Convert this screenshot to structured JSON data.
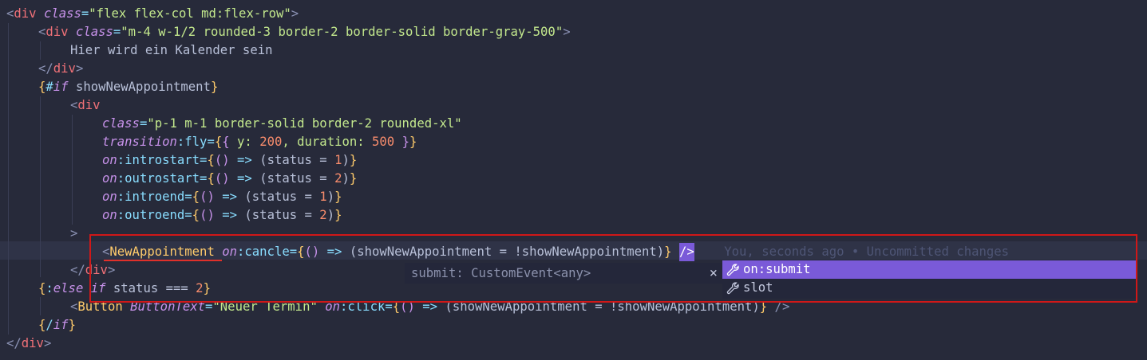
{
  "editor": {
    "lines": [
      {
        "tokens": [
          {
            "t": "<",
            "c": "lt"
          },
          {
            "t": "div",
            "c": "tag"
          },
          {
            "t": " ",
            "c": "plain"
          },
          {
            "t": "class",
            "c": "attr"
          },
          {
            "t": "=",
            "c": "op"
          },
          {
            "t": "\"flex flex-col md:flex-row\"",
            "c": "str"
          },
          {
            "t": ">",
            "c": "lt"
          }
        ]
      },
      {
        "tokens": [
          {
            "t": "<",
            "c": "lt"
          },
          {
            "t": "div",
            "c": "tag"
          },
          {
            "t": " ",
            "c": "plain"
          },
          {
            "t": "class",
            "c": "attr"
          },
          {
            "t": "=",
            "c": "op"
          },
          {
            "t": "\"m-4 w-1/2 rounded-3 border-2 border-solid border-gray-500\"",
            "c": "str"
          },
          {
            "t": ">",
            "c": "lt"
          }
        ]
      },
      {
        "tokens": [
          {
            "t": "Hier wird ein Kalender sein",
            "c": "plain"
          }
        ]
      },
      {
        "tokens": [
          {
            "t": "</",
            "c": "lt"
          },
          {
            "t": "div",
            "c": "tag"
          },
          {
            "t": ">",
            "c": "lt"
          }
        ]
      },
      {
        "tokens": [
          {
            "t": "{",
            "c": "brace"
          },
          {
            "t": "#",
            "c": "op"
          },
          {
            "t": "if",
            "c": "kw"
          },
          {
            "t": " showNewAppointment",
            "c": "plain"
          },
          {
            "t": "}",
            "c": "brace"
          }
        ]
      },
      {
        "tokens": [
          {
            "t": "<",
            "c": "lt"
          },
          {
            "t": "div",
            "c": "tag"
          }
        ]
      },
      {
        "tokens": [
          {
            "t": "class",
            "c": "attr"
          },
          {
            "t": "=",
            "c": "op"
          },
          {
            "t": "\"p-1 m-1 border-solid border-2 rounded-xl\"",
            "c": "str"
          }
        ]
      },
      {
        "tokens": [
          {
            "t": "transition",
            "c": "attr"
          },
          {
            "t": ":fly=",
            "c": "op"
          },
          {
            "t": "{",
            "c": "brace"
          },
          {
            "t": "{",
            "c": "brace2"
          },
          {
            "t": " y: ",
            "c": "prop"
          },
          {
            "t": "200",
            "c": "num"
          },
          {
            "t": ", duration: ",
            "c": "prop"
          },
          {
            "t": "500",
            "c": "num"
          },
          {
            "t": " }",
            "c": "brace2"
          },
          {
            "t": "}",
            "c": "brace"
          }
        ]
      },
      {
        "tokens": [
          {
            "t": "on",
            "c": "attr"
          },
          {
            "t": ":introstart=",
            "c": "op"
          },
          {
            "t": "{",
            "c": "brace"
          },
          {
            "t": "()",
            "c": "brace2"
          },
          {
            "t": " => ",
            "c": "op"
          },
          {
            "t": "(status = ",
            "c": "plain"
          },
          {
            "t": "1",
            "c": "num"
          },
          {
            "t": ")",
            "c": "plain"
          },
          {
            "t": "}",
            "c": "brace"
          }
        ]
      },
      {
        "tokens": [
          {
            "t": "on",
            "c": "attr"
          },
          {
            "t": ":outrostart=",
            "c": "op"
          },
          {
            "t": "{",
            "c": "brace"
          },
          {
            "t": "()",
            "c": "brace2"
          },
          {
            "t": " => ",
            "c": "op"
          },
          {
            "t": "(status = ",
            "c": "plain"
          },
          {
            "t": "2",
            "c": "num"
          },
          {
            "t": ")",
            "c": "plain"
          },
          {
            "t": "}",
            "c": "brace"
          }
        ]
      },
      {
        "tokens": [
          {
            "t": "on",
            "c": "attr"
          },
          {
            "t": ":introend=",
            "c": "op"
          },
          {
            "t": "{",
            "c": "brace"
          },
          {
            "t": "()",
            "c": "brace2"
          },
          {
            "t": " => ",
            "c": "op"
          },
          {
            "t": "(status = ",
            "c": "plain"
          },
          {
            "t": "1",
            "c": "num"
          },
          {
            "t": ")",
            "c": "plain"
          },
          {
            "t": "}",
            "c": "brace"
          }
        ]
      },
      {
        "tokens": [
          {
            "t": "on",
            "c": "attr"
          },
          {
            "t": ":outroend=",
            "c": "op"
          },
          {
            "t": "{",
            "c": "brace"
          },
          {
            "t": "()",
            "c": "brace2"
          },
          {
            "t": " => ",
            "c": "op"
          },
          {
            "t": "(status = ",
            "c": "plain"
          },
          {
            "t": "2",
            "c": "num"
          },
          {
            "t": ")",
            "c": "plain"
          },
          {
            "t": "}",
            "c": "brace"
          }
        ]
      },
      {
        "tokens": [
          {
            "t": ">",
            "c": "lt"
          }
        ]
      },
      {
        "tokens": [
          {
            "t": "<",
            "c": "lt"
          },
          {
            "t": "NewAppointment",
            "c": "comp"
          },
          {
            "t": " ",
            "c": "plain"
          },
          {
            "t": "on",
            "c": "attr"
          },
          {
            "t": ":cancle=",
            "c": "op"
          },
          {
            "t": "{",
            "c": "brace"
          },
          {
            "t": "()",
            "c": "brace2"
          },
          {
            "t": " => ",
            "c": "op"
          },
          {
            "t": "(showNewAppointment = !showNewAppointment)",
            "c": "plain"
          },
          {
            "t": "}",
            "c": "brace"
          },
          {
            "t": " ",
            "c": "plain"
          }
        ]
      },
      {
        "tokens": [
          {
            "t": "</",
            "c": "lt"
          },
          {
            "t": "div",
            "c": "tag"
          },
          {
            "t": ">",
            "c": "lt"
          }
        ]
      },
      {
        "tokens": [
          {
            "t": "{",
            "c": "brace"
          },
          {
            "t": ":",
            "c": "op"
          },
          {
            "t": "else if",
            "c": "kw"
          },
          {
            "t": " status === ",
            "c": "plain"
          },
          {
            "t": "2",
            "c": "num"
          },
          {
            "t": "}",
            "c": "brace"
          }
        ]
      },
      {
        "tokens": [
          {
            "t": "<",
            "c": "lt"
          },
          {
            "t": "Button",
            "c": "comp"
          },
          {
            "t": " ",
            "c": "plain"
          },
          {
            "t": "ButtonText",
            "c": "attr"
          },
          {
            "t": "=",
            "c": "op"
          },
          {
            "t": "\"Neuer Termin\"",
            "c": "str"
          },
          {
            "t": " ",
            "c": "plain"
          },
          {
            "t": "on",
            "c": "attr"
          },
          {
            "t": ":click=",
            "c": "op"
          },
          {
            "t": "{",
            "c": "brace"
          },
          {
            "t": "()",
            "c": "brace2"
          },
          {
            "t": " => ",
            "c": "op"
          },
          {
            "t": "(showNewAppointment = !showNewAppointment)",
            "c": "plain"
          },
          {
            "t": "}",
            "c": "brace"
          },
          {
            "t": " />",
            "c": "lt"
          }
        ]
      },
      {
        "tokens": [
          {
            "t": "{",
            "c": "brace"
          },
          {
            "t": "/",
            "c": "op"
          },
          {
            "t": "if",
            "c": "kw"
          },
          {
            "t": "}",
            "c": "brace"
          }
        ]
      },
      {
        "tokens": [
          {
            "t": "</",
            "c": "lt"
          },
          {
            "t": "div",
            "c": "tag"
          },
          {
            "t": ">",
            "c": "lt"
          }
        ]
      }
    ],
    "cursor_token": "/>",
    "blame_text": "You, seconds ago • Uncommitted changes",
    "hover_text": "submit: CustomEvent<any>",
    "hover_close": "×",
    "suggestions": [
      {
        "label": "on:submit",
        "selected": true,
        "icon": "wrench-icon"
      },
      {
        "label": "slot",
        "selected": false,
        "icon": "wrench-icon"
      }
    ]
  },
  "colors": {
    "background": "#272a3a",
    "selection": "#7a5ad8",
    "highlight_box": "#d01818"
  }
}
